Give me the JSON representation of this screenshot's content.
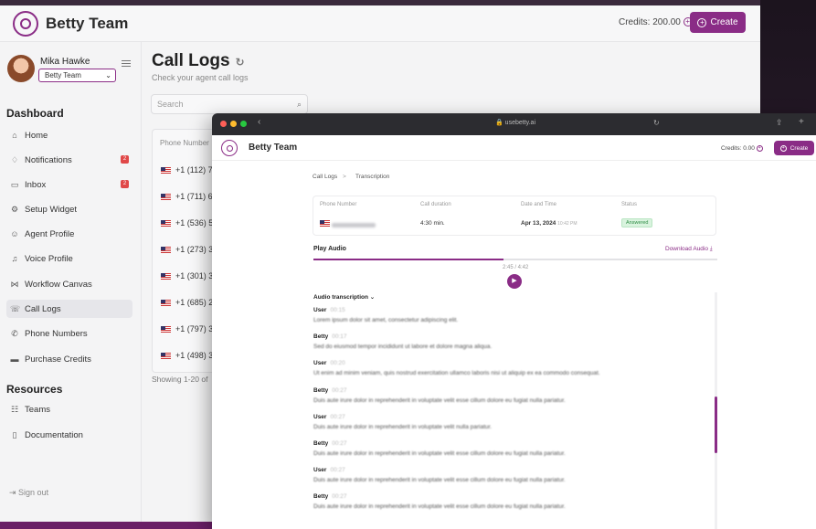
{
  "back_app": {
    "brand": "Betty Team",
    "credits": "Credits: 200.00",
    "create_label": "Create",
    "user": {
      "name": "Mika Hawke",
      "team": "Betty Team"
    },
    "sections": {
      "dashboard": "Dashboard",
      "resources": "Resources"
    },
    "nav": [
      {
        "label": "Home",
        "icon": "home-icon"
      },
      {
        "label": "Notifications",
        "icon": "bell-icon",
        "badge": "2"
      },
      {
        "label": "Inbox",
        "icon": "inbox-icon",
        "badge": "2"
      },
      {
        "label": "Setup Widget",
        "icon": "gear-icon"
      },
      {
        "label": "Agent Profile",
        "icon": "user-icon"
      },
      {
        "label": "Voice Profile",
        "icon": "voice-icon"
      },
      {
        "label": "Workflow Canvas",
        "icon": "workflow-icon"
      },
      {
        "label": "Call Logs",
        "icon": "call-log-icon",
        "active": true
      },
      {
        "label": "Phone Numbers",
        "icon": "phone-icon"
      },
      {
        "label": "Purchase Credits",
        "icon": "card-icon"
      }
    ],
    "resources_nav": [
      {
        "label": "Teams",
        "icon": "team-icon"
      },
      {
        "label": "Documentation",
        "icon": "book-icon"
      }
    ],
    "sign_out": "Sign out",
    "page": {
      "title": "Call Logs",
      "subtitle": "Check your agent call logs",
      "search_placeholder": "Search",
      "col_phone": "Phone Number",
      "rows": [
        "+1 (112) 7",
        "+1 (711) 6",
        "+1 (536) 5",
        "+1 (273) 3",
        "+1 (301) 3",
        "+1 (685) 2",
        "+1 (797) 3",
        "+1 (498) 3"
      ],
      "showing": "Showing 1-20 of"
    }
  },
  "front_app": {
    "url": "usebetty.ai",
    "brand": "Betty Team",
    "credits": "Credits: 0.00",
    "create_label": "Create",
    "breadcrumb": {
      "root": "Call Logs",
      "sep": ">",
      "current": "Transcription"
    },
    "detail": {
      "headers": [
        "Phone Number",
        "Call duration",
        "Date and Time",
        "Status"
      ],
      "duration": "4:30 min.",
      "date": "Apr 13, 2024",
      "time": "10:42 PM",
      "status": "Answered"
    },
    "audio": {
      "title": "Play Audio",
      "download": "Download Audio",
      "time": "2:45 / 4:42",
      "progress": 0.47
    },
    "transcription": {
      "title": "Audio transcription",
      "entries": [
        {
          "speaker": "User",
          "time": "00:15",
          "text": "Lorem ipsum dolor sit amet, consectetur adipiscing elit."
        },
        {
          "speaker": "Betty",
          "time": "00:17",
          "text": "Sed do eiusmod tempor incididunt ut labore et dolore magna aliqua."
        },
        {
          "speaker": "User",
          "time": "00:20",
          "text": "Ut enim ad minim veniam, quis nostrud exercitation ullamco laboris nisi ut aliquip ex ea commodo consequat."
        },
        {
          "speaker": "Betty",
          "time": "00:27",
          "text": "Duis aute irure dolor in reprehenderit in voluptate velit esse cillum dolore eu fugiat nulla pariatur."
        },
        {
          "speaker": "User",
          "time": "00:27",
          "text": "Duis aute irure dolor in reprehenderit in voluptate velit nulla pariatur."
        },
        {
          "speaker": "Betty",
          "time": "00:27",
          "text": "Duis aute irure dolor in reprehenderit in voluptate velit esse cillum dolore eu fugiat nulla pariatur."
        },
        {
          "speaker": "User",
          "time": "00:27",
          "text": "Duis aute irure dolor in reprehenderit in voluptate velit esse cillum dolore eu fugiat nulla pariatur."
        },
        {
          "speaker": "Betty",
          "time": "00:27",
          "text": "Duis aute irure dolor in reprehenderit in voluptate velit esse cillum dolore eu fugiat nulla pariatur."
        }
      ]
    }
  },
  "colors": {
    "accent": "#8a2c86",
    "badge": "#e04848",
    "answered_bg": "#d9f3de"
  }
}
